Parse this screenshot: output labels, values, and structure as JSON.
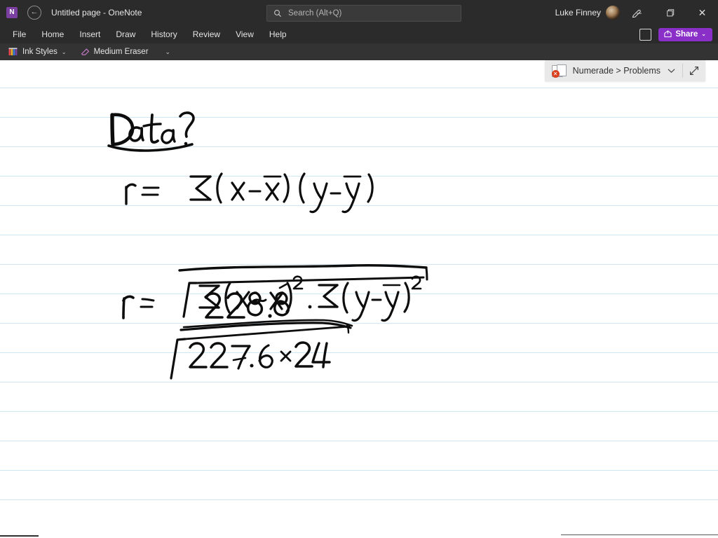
{
  "window": {
    "app_logo_glyph": "N",
    "back_icon": "back-arrow-icon",
    "title": "Untitled page  -  OneNote"
  },
  "search": {
    "placeholder": "Search (Alt+Q)",
    "value": "",
    "icon": "search-icon"
  },
  "account": {
    "user_name": "Luke Finney",
    "avatar": "user-avatar",
    "pen_icon": "pen-icon"
  },
  "window_controls": {
    "minimize": "–",
    "restore": "❐",
    "close": "✕"
  },
  "menu": {
    "items": [
      {
        "label": "File"
      },
      {
        "label": "Home"
      },
      {
        "label": "Insert"
      },
      {
        "label": "Draw"
      },
      {
        "label": "History"
      },
      {
        "label": "Review"
      },
      {
        "label": "View"
      },
      {
        "label": "Help"
      }
    ],
    "notes_button_icon": "note-page-icon",
    "share_label": "Share",
    "share_caret": "⌄",
    "share_color": "#8b2fc9"
  },
  "ribbon": {
    "ink_styles_label": "Ink Styles",
    "ink_styles_caret": "⌄",
    "eraser_label": "Medium Eraser",
    "overflow_caret": "⌄"
  },
  "notebook_chip": {
    "label": "Numerade > Problems",
    "caret": "⌄",
    "error_badge": "✕",
    "expand_icon": "expand-diagonal-icon"
  },
  "canvas": {
    "rule_color": "#cfe7f2",
    "ink_color": "#101010",
    "notes": [
      {
        "id": "heading",
        "text": "Data ?",
        "kind": "handwritten-heading-underlined"
      },
      {
        "id": "formula-1",
        "text": "r = Σ(x-x̄)(y-ȳ) / √[ Σ(x-x̄)² · Σ(y-ȳ)² ]",
        "kind": "handwritten-formula",
        "numerator": "Σ (x - x̄)(y - ȳ)",
        "denominator": "√ Σ (x - x̄)² · Σ (y - ȳ)²"
      },
      {
        "id": "formula-2",
        "text": "r = 228.8 / √(227.6 × 24)",
        "kind": "handwritten-formula",
        "numerator": "228.8",
        "denominator": "√ 227.6 × 24"
      }
    ]
  }
}
